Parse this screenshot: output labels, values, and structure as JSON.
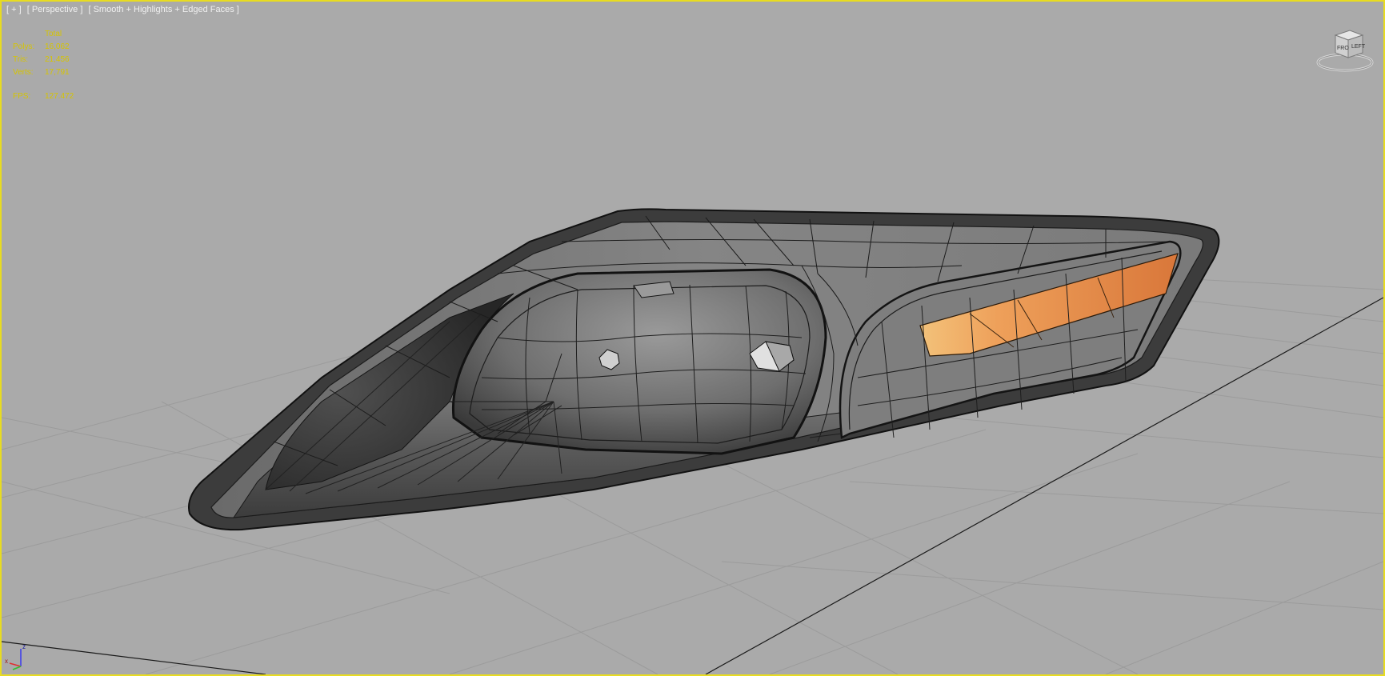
{
  "viewport": {
    "label_parts": [
      "[ + ]",
      "[ Perspective ]",
      "[ Smooth + Highlights + Edged Faces ]"
    ]
  },
  "stats": {
    "header": "Total",
    "rows": [
      {
        "key": "Polys:",
        "value": "16,062"
      },
      {
        "key": "Tris:",
        "value": "21,456"
      },
      {
        "key": "Verts:",
        "value": "17,791"
      }
    ],
    "fps_key": "FPS:",
    "fps_value": "127.472"
  },
  "viewcube": {
    "face_front": "FRO",
    "face_left": "LEFT"
  },
  "axis": {
    "x": "x",
    "z": "z"
  },
  "colors": {
    "border": "#e8dc20",
    "background": "#aaaaaa",
    "stats_text": "#d6c400",
    "amber_reflector": "#e8883a"
  },
  "model": {
    "name_icon": "headlight-mesh-icon"
  }
}
